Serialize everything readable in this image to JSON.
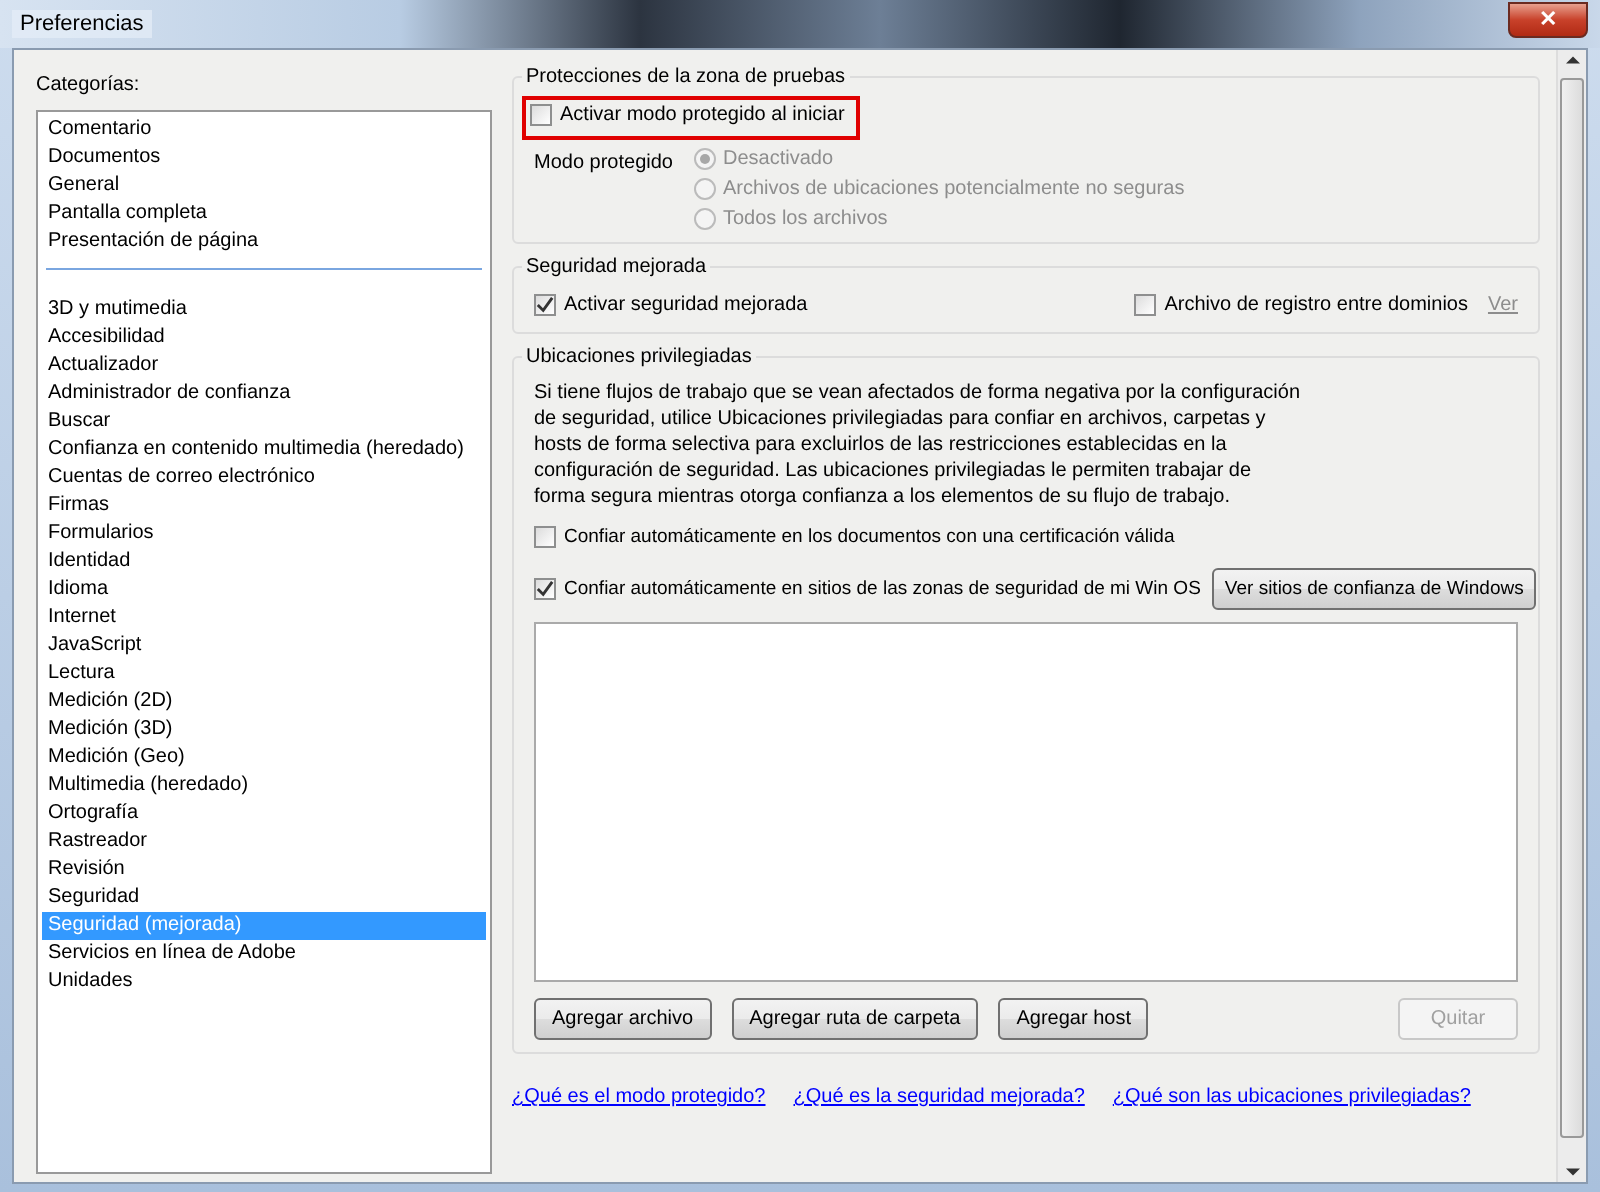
{
  "window": {
    "title": "Preferencias",
    "close_label": "✕"
  },
  "categories": {
    "label": "Categorías:",
    "groups": [
      [
        {
          "label": "Comentario",
          "selected": false
        },
        {
          "label": "Documentos",
          "selected": false
        },
        {
          "label": "General",
          "selected": false
        },
        {
          "label": "Pantalla completa",
          "selected": false
        },
        {
          "label": "Presentación de página",
          "selected": false
        }
      ],
      [
        {
          "label": "3D y mutimedia",
          "selected": false
        },
        {
          "label": "Accesibilidad",
          "selected": false
        },
        {
          "label": "Actualizador",
          "selected": false
        },
        {
          "label": "Administrador de confianza",
          "selected": false
        },
        {
          "label": "Buscar",
          "selected": false
        },
        {
          "label": "Confianza en contenido multimedia (heredado)",
          "selected": false
        },
        {
          "label": "Cuentas de correo electrónico",
          "selected": false
        },
        {
          "label": "Firmas",
          "selected": false
        },
        {
          "label": "Formularios",
          "selected": false
        },
        {
          "label": "Identidad",
          "selected": false
        },
        {
          "label": "Idioma",
          "selected": false
        },
        {
          "label": "Internet",
          "selected": false
        },
        {
          "label": "JavaScript",
          "selected": false
        },
        {
          "label": "Lectura",
          "selected": false
        },
        {
          "label": "Medición (2D)",
          "selected": false
        },
        {
          "label": "Medición (3D)",
          "selected": false
        },
        {
          "label": "Medición (Geo)",
          "selected": false
        },
        {
          "label": "Multimedia (heredado)",
          "selected": false
        },
        {
          "label": "Ortografía",
          "selected": false
        },
        {
          "label": "Rastreador",
          "selected": false
        },
        {
          "label": "Revisión",
          "selected": false
        },
        {
          "label": "Seguridad",
          "selected": false
        },
        {
          "label": "Seguridad (mejorada)",
          "selected": true
        },
        {
          "label": "Servicios en línea de Adobe",
          "selected": false
        },
        {
          "label": "Unidades",
          "selected": false
        }
      ]
    ]
  },
  "sandbox": {
    "title": "Protecciones de la zona de pruebas",
    "checkbox": {
      "label": "Activar modo protegido al iniciar",
      "checked": false,
      "highlighted": true
    },
    "mode_label": "Modo protegido",
    "options": [
      {
        "label": "Desactivado",
        "selected": true,
        "disabled": true
      },
      {
        "label": "Archivos de ubicaciones potencialmente no seguras",
        "selected": false,
        "disabled": true
      },
      {
        "label": "Todos los archivos",
        "selected": false,
        "disabled": true
      }
    ]
  },
  "enhanced": {
    "title": "Seguridad mejorada",
    "checkboxes": [
      {
        "label": "Activar seguridad mejorada",
        "checked": true
      },
      {
        "label": "Archivo de registro entre dominios",
        "checked": false
      }
    ],
    "link": {
      "label": "Ver",
      "disabled": true
    }
  },
  "privileged": {
    "title": "Ubicaciones privilegiadas",
    "description": "Si tiene flujos de trabajo que se vean afectados de forma negativa por la configuración de seguridad, utilice Ubicaciones privilegiadas para confiar en archivos, carpetas y hosts de forma selectiva para excluirlos de las restricciones establecidas en la configuración de seguridad. Las ubicaciones privilegiadas le permiten trabajar de forma segura mientras otorga confianza a los elementos de su flujo de trabajo.",
    "checkboxes": [
      {
        "label": "Confiar automáticamente en los documentos con una certificación válida",
        "checked": false
      },
      {
        "label": "Confiar automáticamente en sitios de las zonas de seguridad de mi Win OS",
        "checked": true
      }
    ],
    "sites_button": "Ver sitios de confianza de Windows",
    "buttons": [
      {
        "label": "Agregar archivo",
        "disabled": false
      },
      {
        "label": "Agregar ruta de carpeta",
        "disabled": false
      },
      {
        "label": "Agregar host",
        "disabled": false
      },
      {
        "label": "Quitar",
        "disabled": true
      }
    ]
  },
  "help_links": [
    "¿Qué es el modo protegido?",
    "¿Qué es la seguridad mejorada?",
    "¿Qué son las ubicaciones privilegiadas?"
  ]
}
